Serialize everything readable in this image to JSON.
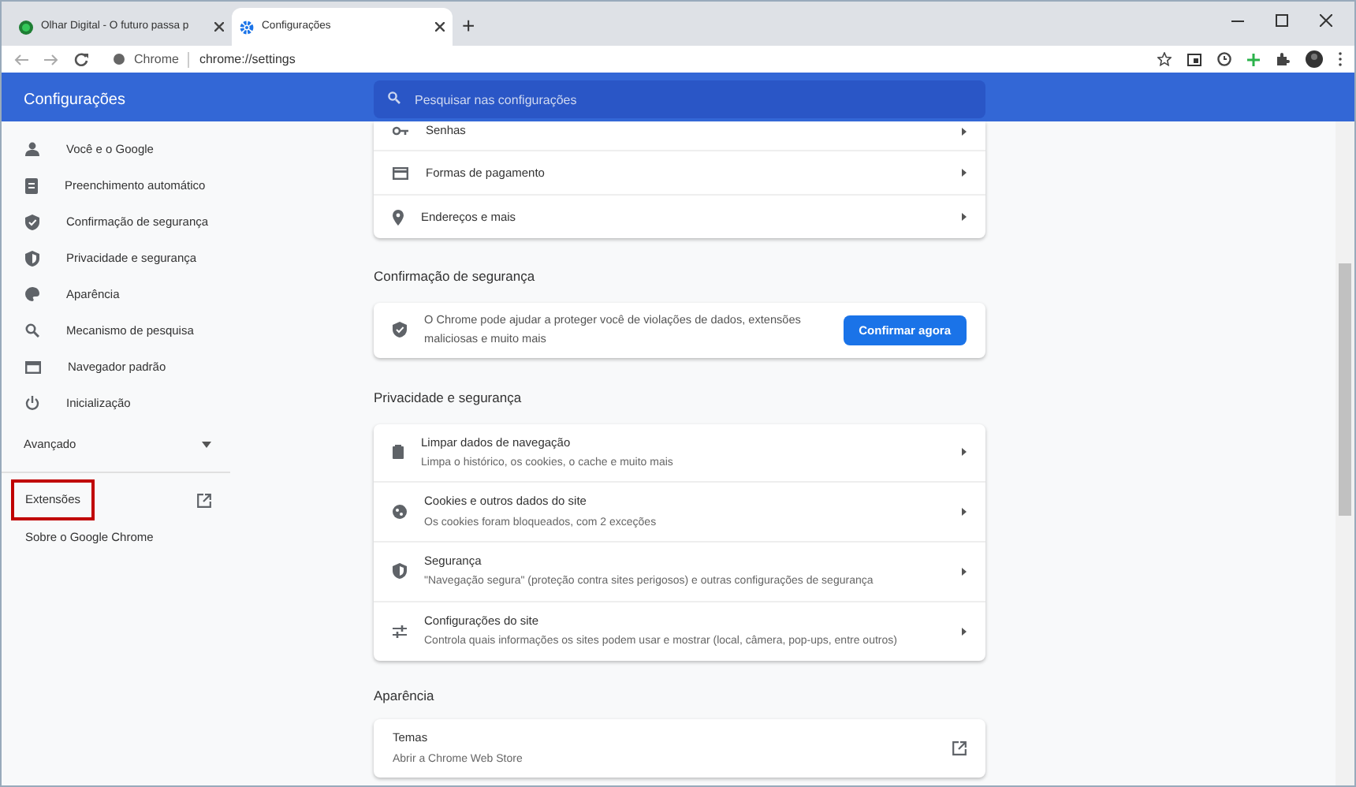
{
  "tabs": [
    {
      "title": "Olhar Digital - O futuro passa p",
      "selected": false
    },
    {
      "title": "Configurações",
      "selected": true
    }
  ],
  "new_tab_button": {
    "label": "+"
  },
  "address_bar": {
    "site_label": "Chrome",
    "url": "chrome://settings"
  },
  "header": {
    "title": "Configurações",
    "search": {
      "placeholder": "Pesquisar nas configurações"
    }
  },
  "sidebar": {
    "items": [
      {
        "label": "Você e o Google"
      },
      {
        "label": "Preenchimento automático"
      },
      {
        "label": "Confirmação de segurança"
      },
      {
        "label": "Privacidade e segurança"
      },
      {
        "label": "Aparência"
      },
      {
        "label": "Mecanismo de pesquisa"
      },
      {
        "label": "Navegador padrão"
      },
      {
        "label": "Inicialização"
      }
    ],
    "advanced": {
      "label": "Avançado",
      "expanded": false
    },
    "links": [
      {
        "label": "Extensões",
        "highlighted": true,
        "external": true
      },
      {
        "label": "Sobre o Google Chrome",
        "highlighted": false,
        "external": false
      }
    ]
  },
  "autofill_rows": [
    {
      "label": "Senhas"
    },
    {
      "label": "Formas de pagamento"
    },
    {
      "label": "Endereços e mais"
    }
  ],
  "safety_check": {
    "heading": "Confirmação de segurança",
    "text": "O Chrome pode ajudar a proteger você de violações de dados, extensões maliciosas e muito mais",
    "button": "Confirmar agora"
  },
  "privacy": {
    "heading": "Privacidade e segurança",
    "rows": [
      {
        "title": "Limpar dados de navegação",
        "subtitle": "Limpa o histórico, os cookies, o cache e muito mais"
      },
      {
        "title": "Cookies e outros dados do site",
        "subtitle": "Os cookies foram bloqueados, com 2 exceções"
      },
      {
        "title": "Segurança",
        "subtitle": "\"Navegação segura\" (proteção contra sites perigosos) e outras configurações de segurança"
      },
      {
        "title": "Configurações do site",
        "subtitle": "Controla quais informações os sites podem usar e mostrar (local, câmera, pop-ups, entre outros)"
      }
    ]
  },
  "appearance": {
    "heading": "Aparência",
    "rows": [
      {
        "title": "Temas",
        "subtitle": "Abrir a Chrome Web Store"
      }
    ]
  }
}
